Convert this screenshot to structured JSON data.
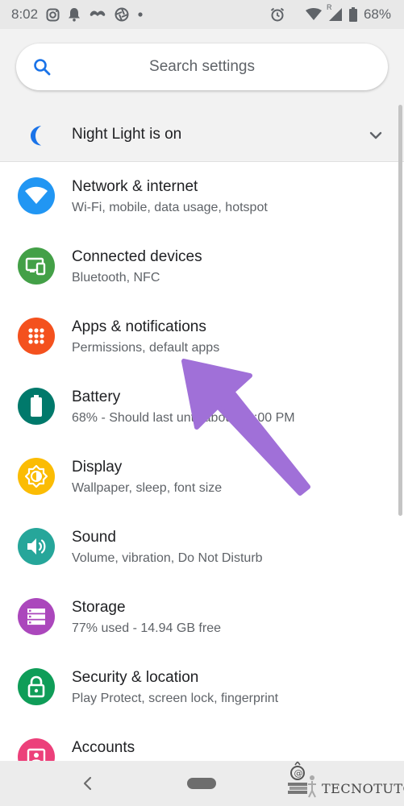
{
  "status_bar": {
    "time": "8:02",
    "battery_text": "68%",
    "notification_icons": [
      "instagram-icon",
      "bell-icon",
      "mustache-icon",
      "aperture-icon",
      "dot-icon"
    ],
    "system_icons": [
      "alarm-icon",
      "wifi-icon",
      "signal-icon",
      "battery-icon"
    ],
    "signal_badge": "R"
  },
  "search": {
    "placeholder": "Search settings",
    "icon": "search-icon",
    "accent": "#1a73e8"
  },
  "night_light": {
    "label": "Night Light is on",
    "icon": "moon-icon",
    "color": "#1a73e8"
  },
  "settings": [
    {
      "title": "Network & internet",
      "subtitle": "Wi-Fi, mobile, data usage, hotspot",
      "icon": "wifi-icon",
      "color": "#2196f3"
    },
    {
      "title": "Connected devices",
      "subtitle": "Bluetooth, NFC",
      "icon": "devices-icon",
      "color": "#43a047"
    },
    {
      "title": "Apps & notifications",
      "subtitle": "Permissions, default apps",
      "icon": "apps-grid-icon",
      "color": "#f4511e"
    },
    {
      "title": "Battery",
      "subtitle": "68% - Should last until about 12:00 PM",
      "icon": "battery-icon",
      "color": "#00796b"
    },
    {
      "title": "Display",
      "subtitle": "Wallpaper, sleep, font size",
      "icon": "brightness-icon",
      "color": "#fbbc04"
    },
    {
      "title": "Sound",
      "subtitle": "Volume, vibration, Do Not Disturb",
      "icon": "speaker-icon",
      "color": "#26a69a"
    },
    {
      "title": "Storage",
      "subtitle": "77% used - 14.94 GB free",
      "icon": "storage-icon",
      "color": "#ab47bc"
    },
    {
      "title": "Security & location",
      "subtitle": "Play Protect, screen lock, fingerprint",
      "icon": "lock-icon",
      "color": "#0f9d58"
    },
    {
      "title": "Accounts",
      "subtitle": "",
      "icon": "account-icon",
      "color": "#ec407a"
    }
  ],
  "annotation": {
    "arrow_color": "#a070d8"
  },
  "nav_bar": {
    "back_icon": "back-chevron-icon",
    "home_icon": "home-pill-icon"
  },
  "watermark": {
    "text": "TECNOTUTO"
  }
}
